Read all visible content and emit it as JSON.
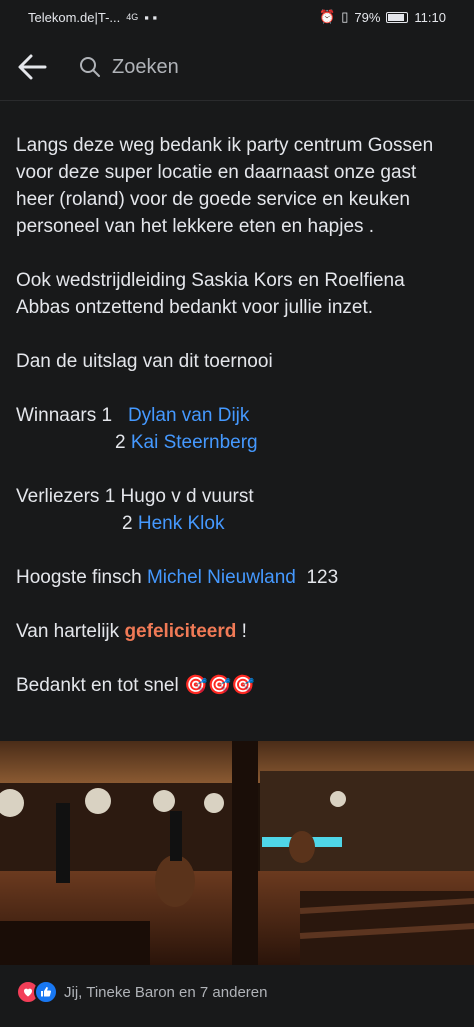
{
  "status_bar": {
    "carrier": "Telekom.de|T-...",
    "network": "4G",
    "battery": "79%",
    "time": "11:10"
  },
  "header": {
    "search_placeholder": "Zoeken"
  },
  "post": {
    "thanks": "Langs deze weg bedank ik party centrum Gossen  voor deze super locatie en daarnaast onze gast heer (roland) voor de goede service en keuken personeel van het lekkere eten en hapjes .",
    "organisers_prefix": "Ook wedstrijdleiding  Saskia Kors  en Roelfiena Abbas ontzettend bedankt voor jullie inzet.",
    "results_intro": "Dan de uitslag van dit toernooi",
    "winners_label": "Winnaars 1",
    "winner_1": "Dylan van Dijk",
    "winner_2_num": "2",
    "winner_2": "Kai Steernberg",
    "losers_label": "Verliezers 1 Hugo v d vuurst",
    "loser_2_num": "2",
    "loser_2": "Henk Klok",
    "finish_label": "Hoogste finsch",
    "finish_player": "Michel Nieuwland",
    "finish_score": "123",
    "congrats_prefix": "Van hartelijk",
    "congrats_word": "gefeliciteerd",
    "congrats_suffix": "!",
    "closing": "Bedankt en tot snel",
    "closing_emoji": "🎯🎯🎯"
  },
  "reactions": {
    "text": "Jij, Tineke Baron en 7 anderen"
  },
  "colors": {
    "background": "#18191a",
    "link": "#4599ff",
    "accent": "#f07a56"
  }
}
